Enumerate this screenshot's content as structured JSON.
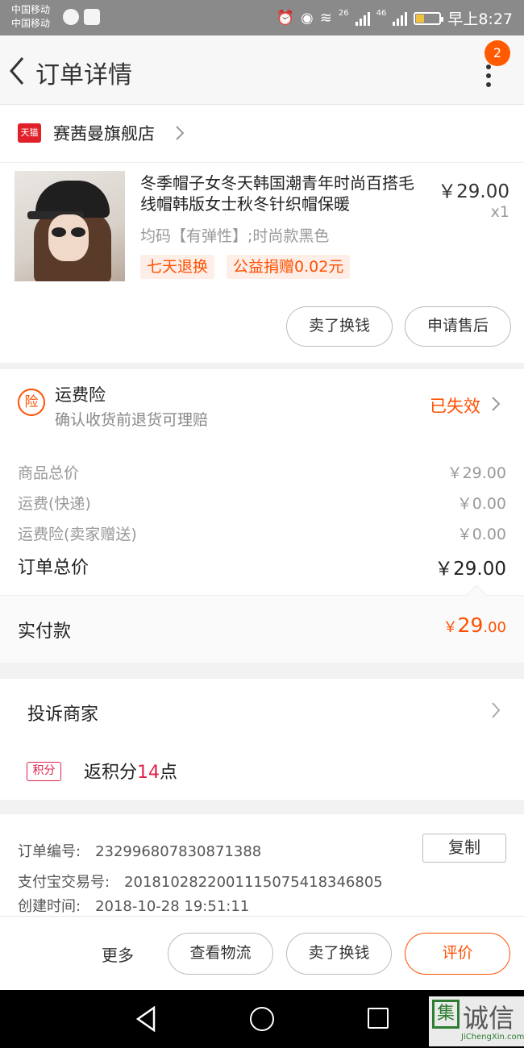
{
  "status_bar": {
    "carrier_1": "中国移动",
    "carrier_2": "中国移动",
    "network_1": "26",
    "network_2": "46",
    "time": "早上8:27"
  },
  "header": {
    "title": "订单详情",
    "badge_count": "2"
  },
  "shop": {
    "logo_text": "天猫",
    "name": "赛茜曼旗舰店"
  },
  "product": {
    "title": "冬季帽子女冬天韩国潮青年时尚百搭毛线帽韩版女士秋冬针织帽保暖",
    "price": "￥29.00",
    "quantity": "x1",
    "sku": "均码【有弹性】;时尚款黑色",
    "tags": [
      "七天退换",
      "公益捐赠0.02元"
    ],
    "buttons": {
      "sell": "卖了换钱",
      "after_sale": "申请售后"
    }
  },
  "insurance": {
    "icon_text": "险",
    "title": "运费险",
    "description": "确认收货前退货可理赔",
    "status": "已失效"
  },
  "summary": {
    "rows": [
      {
        "label": "商品总价",
        "value": "￥29.00"
      },
      {
        "label": "运费(快递)",
        "value": "￥0.00"
      },
      {
        "label": "运费险(卖家赠送)",
        "value": "￥0.00"
      }
    ],
    "total_label": "订单总价",
    "total_value": "￥29.00"
  },
  "payment": {
    "label": "实付款",
    "currency": "￥",
    "amount_int": "29",
    "amount_dec": ".00"
  },
  "complaint": {
    "label": "投诉商家"
  },
  "points": {
    "icon_text": "积分",
    "prefix": "返积分",
    "count": "14",
    "suffix": "点"
  },
  "order_info": {
    "order_no_label": "订单编号:",
    "order_no": "232996807830871388",
    "copy_label": "复制",
    "alipay_label": "支付宝交易号:",
    "alipay_no": "2018102822001115075418346805",
    "created_label": "创建时间:",
    "created_at": "2018-10-28 19:51:11"
  },
  "action_bar": {
    "more": "更多",
    "logistics": "查看物流",
    "sell": "卖了换钱",
    "review": "评价"
  },
  "watermark": {
    "logo": "集",
    "text": "诚信",
    "sub": "JiChengXin.com"
  },
  "colors": {
    "accent": "#ff5000",
    "tmall_red": "#e0212a",
    "points_red": "#e0204a"
  }
}
